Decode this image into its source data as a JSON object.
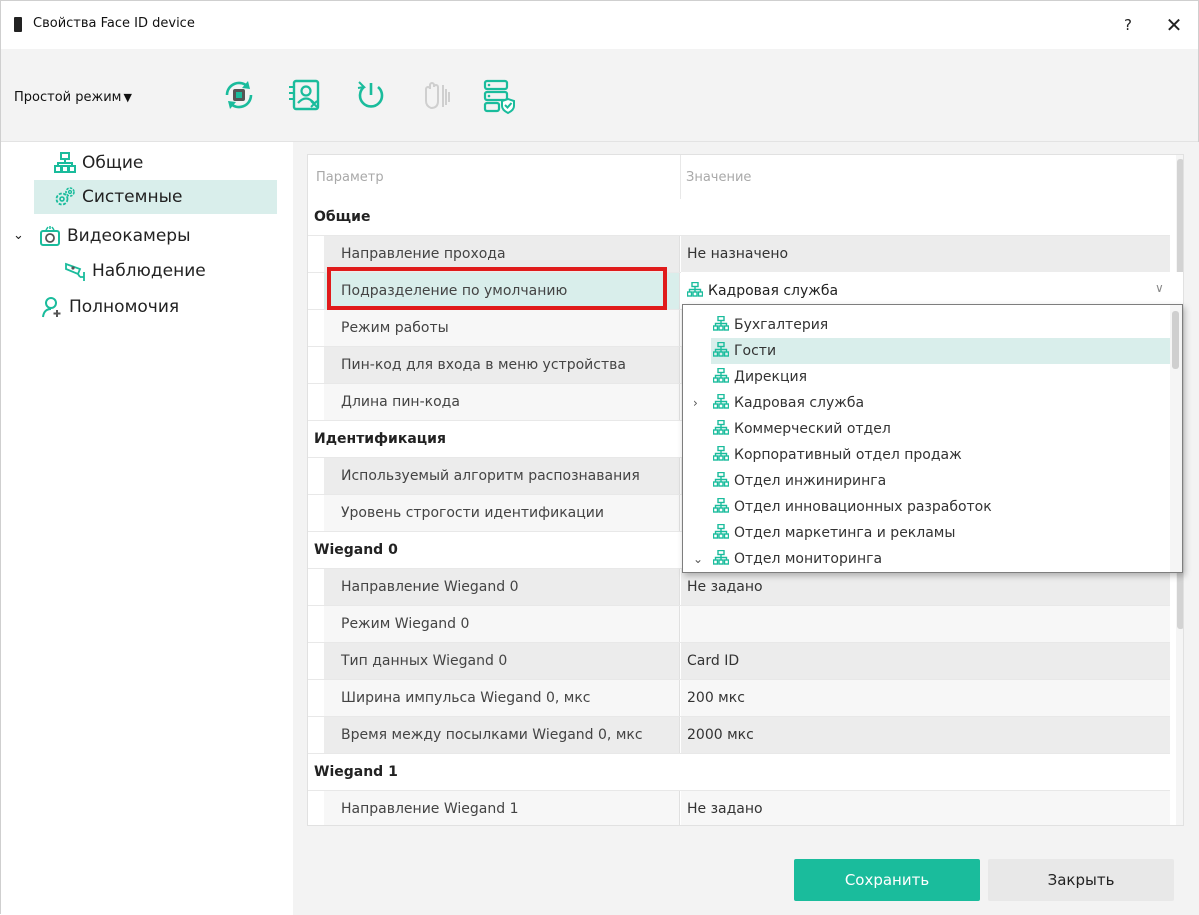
{
  "window": {
    "title": "Свойства Face ID device",
    "help_label": "?",
    "close_label": "✕"
  },
  "toolbar": {
    "mode_label": "Простой режим",
    "icons": [
      "sync-device-icon",
      "user-card-icon",
      "restart-icon",
      "lock-disabled-icon",
      "database-check-icon"
    ]
  },
  "sidebar": {
    "items": [
      {
        "label": "Общие",
        "icon": "network-icon"
      },
      {
        "label": "Системные",
        "icon": "settings-gears-icon"
      },
      {
        "label": "Видеокамеры",
        "icon": "camera-icon"
      },
      {
        "label": "Наблюдение",
        "icon": "cctv-icon"
      },
      {
        "label": "Полномочия",
        "icon": "user-add-icon"
      }
    ]
  },
  "grid": {
    "col_param": "Параметр",
    "col_value": "Значение",
    "sections": {
      "general": "Общие",
      "identification": "Идентификация",
      "wiegand0": "Wiegand 0",
      "wiegand1": "Wiegand 1"
    },
    "rows": {
      "pass_direction": {
        "label": "Направление прохода",
        "value": "Не назначено"
      },
      "default_dept": {
        "label": "Подразделение по умолчанию",
        "value": "Кадровая служба"
      },
      "work_mode": {
        "label": "Режим работы",
        "value": ""
      },
      "pin_menu": {
        "label": "Пин-код для входа в меню устройства",
        "value": ""
      },
      "pin_length": {
        "label": "Длина пин-кода",
        "value": ""
      },
      "algorithm": {
        "label": "Используемый алгоритм распознавания",
        "value": ""
      },
      "strictness": {
        "label": "Уровень строгости идентификации",
        "value": ""
      },
      "w0_direction": {
        "label": "Направление Wiegand 0",
        "value": "Не задано"
      },
      "w0_mode": {
        "label": "Режим Wiegand 0",
        "value": ""
      },
      "w0_datatype": {
        "label": "Тип данных Wiegand 0",
        "value": "Card ID"
      },
      "w0_pulse": {
        "label": "Ширина импульса Wiegand 0, мкс",
        "value": "200 мкс"
      },
      "w0_interval": {
        "label": "Время между посылками Wiegand 0, мкс",
        "value": "2000 мкс"
      },
      "w1_direction": {
        "label": "Направление Wiegand 1",
        "value": "Не задано"
      }
    }
  },
  "dropdown": {
    "items": [
      "Бухгалтерия",
      "Гости",
      "Дирекция",
      "Кадровая служба",
      "Коммерческий отдел",
      "Корпоративный отдел продаж",
      "Отдел инжиниринга",
      "Отдел инновационных разработок",
      "Отдел маркетинга и рекламы",
      "Отдел мониторинга"
    ],
    "selected": "Гости"
  },
  "buttons": {
    "save": "Сохранить",
    "close": "Закрыть"
  },
  "colors": {
    "accent": "#1abc9c",
    "selection": "#d9eeeb",
    "highlight_border": "#e01b1b",
    "toolbar_bg": "#f3f3f3"
  }
}
